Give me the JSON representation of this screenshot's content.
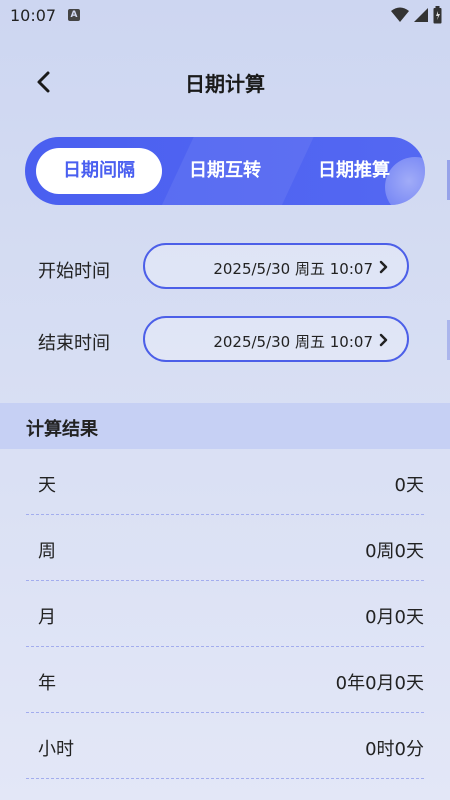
{
  "status_bar": {
    "time": "10:07",
    "notification_icon": "A"
  },
  "header": {
    "title": "日期计算"
  },
  "tabs": [
    {
      "label": "日期间隔",
      "active": true
    },
    {
      "label": "日期互转",
      "active": false
    },
    {
      "label": "日期推算",
      "active": false
    }
  ],
  "start": {
    "label": "开始时间",
    "value": "2025/5/30 周五 10:07"
  },
  "end": {
    "label": "结束时间",
    "value": "2025/5/30 周五 10:07"
  },
  "results": {
    "title": "计算结果",
    "rows": [
      {
        "label": "天",
        "value": "0天"
      },
      {
        "label": "周",
        "value": "0周0天"
      },
      {
        "label": "月",
        "value": "0月0天"
      },
      {
        "label": "年",
        "value": "0年0月0天"
      },
      {
        "label": "小时",
        "value": "0时0分"
      }
    ]
  },
  "colors": {
    "accent": "#4a5ff0",
    "result_header_bg": "#c6d0f4"
  }
}
